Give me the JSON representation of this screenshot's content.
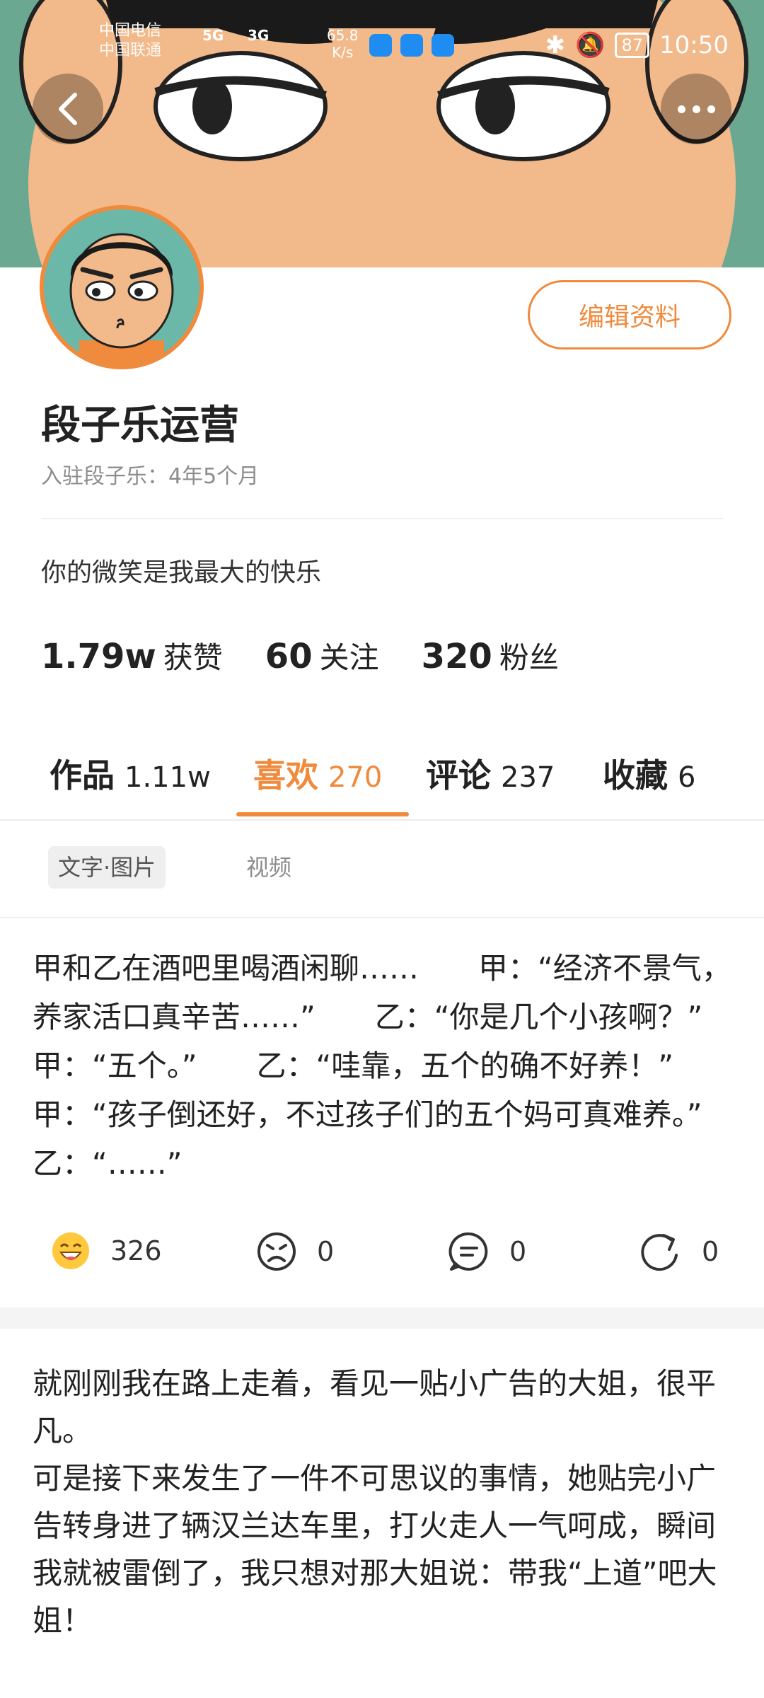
{
  "status_bar": {
    "carrier1": "中国电信",
    "carrier2": "中国联通",
    "net1": "5G",
    "net2": "3G",
    "speed_value": "65.8",
    "speed_unit": "K/s",
    "battery": "87",
    "time": "10:50"
  },
  "profile": {
    "name": "段子乐运营",
    "joined": "入驻段子乐：4年5个月",
    "bio": "你的微笑是我最大的快乐",
    "edit_label": "编辑资料",
    "stats": [
      {
        "num": "1.79w",
        "label": "获赞"
      },
      {
        "num": "60",
        "label": "关注"
      },
      {
        "num": "320",
        "label": "粉丝"
      }
    ]
  },
  "tabs": [
    {
      "label": "作品",
      "count": "1.11w"
    },
    {
      "label": "喜欢",
      "count": "270"
    },
    {
      "label": "评论",
      "count": "237"
    },
    {
      "label": "收藏",
      "count": "6"
    }
  ],
  "filters": {
    "active": "文字·图片",
    "other": "视频"
  },
  "posts": [
    {
      "text": "甲和乙在酒吧里喝酒闲聊……　　甲：“经济不景气，养家活口真辛苦……”　　乙：“你是几个小孩啊？”　　甲：“五个。”　　乙：“哇靠，五个的确不好养！”　　甲：“孩子倒还好，不过孩子们的五个妈可真难养。”　　乙：“……”",
      "likes": "326",
      "dislikes": "0",
      "comments": "0",
      "shares": "0"
    },
    {
      "text": "就刚刚我在路上走着，看见一贴小广告的大姐，很平凡。\n可是接下来发生了一件不可思议的事情，她贴完小广告转身进了辆汉兰达车里，打火走人一气呵成，瞬间我就被雷倒了，我只想对那大姐说：带我“上道”吧大姐！"
    }
  ],
  "colors": {
    "accent": "#f08a3c",
    "banner": "#6aa892",
    "skin": "#f2b98a"
  }
}
